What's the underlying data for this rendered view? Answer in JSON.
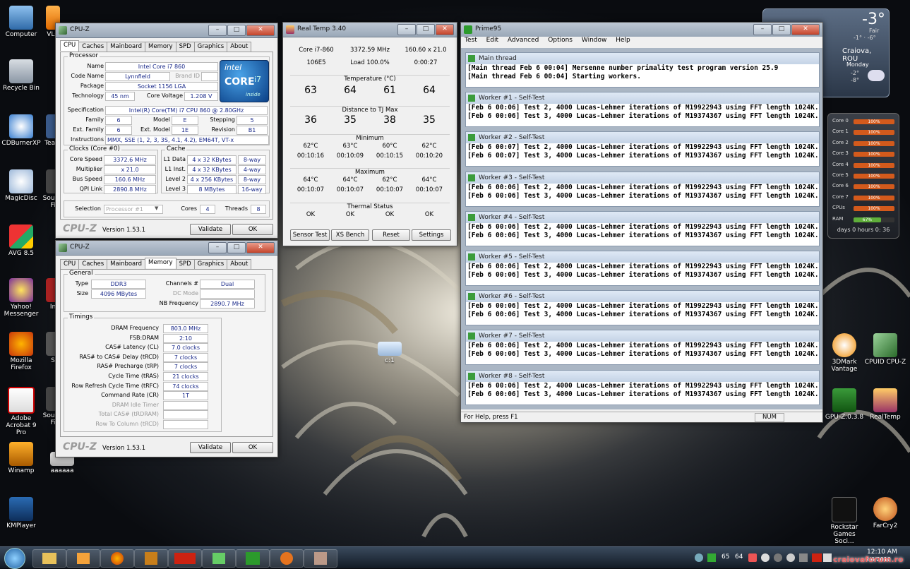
{
  "desktop_icons": [
    "Computer",
    "VLC",
    "Recycle Bin",
    "CDBurnerXP",
    "Team",
    "MagicDisc",
    "Sou X-Fi",
    "AVG 8.5",
    "Yahoo! Messenger",
    "In",
    "Mozilla Firefox",
    "S",
    "Adobe Acrobat 9 Pro",
    "Sou X-Fi",
    "Winamp",
    "aaaaaa",
    "KMPlayer",
    "3DMark Vantage",
    "CPUID CPU-Z",
    "GPU-Z.0.3.8",
    "RealTemp",
    "Rockstar Games Soci...",
    "FarCry2",
    "c:1"
  ],
  "weather": {
    "temp": "-3°",
    "range": "-1° · -6°",
    "cond": "Fair",
    "city": "Craiova, ROU",
    "day": "Monday",
    "lo_hi": "-2°\n-8°"
  },
  "cpuz1": {
    "title": "CPU-Z",
    "tabs": [
      "CPU",
      "Caches",
      "Mainboard",
      "Memory",
      "SPD",
      "Graphics",
      "About"
    ],
    "processor_group": "Processor",
    "name_l": "Name",
    "name": "Intel Core i7 860",
    "codename_l": "Code Name",
    "codename": "Lynnfield",
    "brandid_l": "Brand ID",
    "package_l": "Package",
    "package": "Socket 1156 LGA",
    "tech_l": "Technology",
    "tech": "45 nm",
    "corev_l": "Core Voltage",
    "corev": "1.208 V",
    "spec_l": "Specification",
    "spec": "Intel(R) Core(TM) i7 CPU        860  @ 2.80GHz",
    "family_l": "Family",
    "family": "6",
    "model_l": "Model",
    "model": "E",
    "stepping_l": "Stepping",
    "stepping": "5",
    "extfamily_l": "Ext. Family",
    "extfamily": "6",
    "extmodel_l": "Ext. Model",
    "extmodel": "1E",
    "revision_l": "Revision",
    "revision": "B1",
    "instr_l": "Instructions",
    "instr": "MMX, SSE (1, 2, 3, 3S, 4.1, 4.2), EM64T, VT-x",
    "clocks_group": "Clocks (Core #0)",
    "corespeed_l": "Core Speed",
    "corespeed": "3372.6 MHz",
    "mult_l": "Multiplier",
    "mult": "x 21.0",
    "bus_l": "Bus Speed",
    "bus": "160.6 MHz",
    "qpi_l": "QPI Link",
    "qpi": "2890.8 MHz",
    "cache_group": "Cache",
    "l1d_l": "L1 Data",
    "l1d": "4 x 32 KBytes",
    "l1d_w": "8-way",
    "l1i_l": "L1 Inst.",
    "l1i": "4 x 32 KBytes",
    "l1i_w": "4-way",
    "l2_l": "Level 2",
    "l2": "4 x 256 KBytes",
    "l2_w": "8-way",
    "l3_l": "Level 3",
    "l3": "8 MBytes",
    "l3_w": "16-way",
    "selection_l": "Selection",
    "selection": "Processor #1",
    "cores_l": "Cores",
    "cores": "4",
    "threads_l": "Threads",
    "threads": "8",
    "logo": "CPU-Z",
    "version": "Version 1.53.1",
    "validate": "Validate",
    "ok": "OK",
    "intel_logo": "intel",
    "intel_core": "CORE",
    "intel_i7": "i7",
    "intel_inside": "inside"
  },
  "cpuz2": {
    "title": "CPU-Z",
    "tabs": [
      "CPU",
      "Caches",
      "Mainboard",
      "Memory",
      "SPD",
      "Graphics",
      "About"
    ],
    "general_group": "General",
    "type_l": "Type",
    "type": "DDR3",
    "channels_l": "Channels #",
    "channels": "Dual",
    "size_l": "Size",
    "size": "4096 MBytes",
    "dcmode_l": "DC Mode",
    "nbfreq_l": "NB Frequency",
    "nbfreq": "2890.7 MHz",
    "timings_group": "Timings",
    "timings": [
      {
        "l": "DRAM Frequency",
        "v": "803.0 MHz"
      },
      {
        "l": "FSB:DRAM",
        "v": "2:10"
      },
      {
        "l": "CAS# Latency (CL)",
        "v": "7.0 clocks"
      },
      {
        "l": "RAS# to CAS# Delay (tRCD)",
        "v": "7 clocks"
      },
      {
        "l": "RAS# Precharge (tRP)",
        "v": "7 clocks"
      },
      {
        "l": "Cycle Time (tRAS)",
        "v": "21 clocks"
      },
      {
        "l": "Row Refresh Cycle Time (tRFC)",
        "v": "74 clocks"
      },
      {
        "l": "Command Rate (CR)",
        "v": "1T"
      },
      {
        "l": "DRAM Idle Timer",
        "v": ""
      },
      {
        "l": "Total CAS# (tRDRAM)",
        "v": ""
      },
      {
        "l": "Row To Column (tRCD)",
        "v": ""
      }
    ],
    "logo": "CPU-Z",
    "version": "Version 1.53.1",
    "validate": "Validate",
    "ok": "OK"
  },
  "realtemp": {
    "title": "Real Temp 3.40",
    "cpu": "Core i7-860",
    "mhz": "3372.59 MHz",
    "mult": "160.60 x 21.0",
    "cpuid": "106E5",
    "load": "Load 100.0%",
    "time": "0:00:27",
    "temp_label": "Temperature (°C)",
    "temps": [
      "63",
      "64",
      "61",
      "64"
    ],
    "dist_label": "Distance to TJ Max",
    "dist": [
      "36",
      "35",
      "38",
      "35"
    ],
    "min_label": "Minimum",
    "min": [
      "62°C",
      "63°C",
      "60°C",
      "62°C"
    ],
    "min_t": [
      "00:10:16",
      "00:10:09",
      "00:10:15",
      "00:10:20"
    ],
    "max_label": "Maximum",
    "max": [
      "64°C",
      "64°C",
      "62°C",
      "64°C"
    ],
    "max_t": [
      "00:10:07",
      "00:10:07",
      "00:10:07",
      "00:10:07"
    ],
    "thermal_label": "Thermal Status",
    "thermal": [
      "OK",
      "OK",
      "OK",
      "OK"
    ],
    "buttons": [
      "Sensor Test",
      "XS Bench",
      "Reset",
      "Settings"
    ]
  },
  "prime95": {
    "title": "Prime95",
    "menu": [
      "Test",
      "Edit",
      "Advanced",
      "Options",
      "Window",
      "Help"
    ],
    "panes": [
      {
        "h": "Main thread",
        "l1": "[Main thread Feb 6 00:04] Mersenne number primality test program version 25.9",
        "l2": "[Main thread Feb 6 00:04] Starting workers."
      },
      {
        "h": "Worker #1 - Self-Test",
        "l1": "[Feb 6 00:06] Test 2, 4000 Lucas-Lehmer iterations of M19922943 using FFT length 1024K.",
        "l2": "[Feb 6 00:06] Test 3, 4000 Lucas-Lehmer iterations of M19374367 using FFT length 1024K."
      },
      {
        "h": "Worker #2 - Self-Test",
        "l1": "[Feb 6 00:07] Test 2, 4000 Lucas-Lehmer iterations of M19922943 using FFT length 1024K.",
        "l2": "[Feb 6 00:07] Test 3, 4000 Lucas-Lehmer iterations of M19374367 using FFT length 1024K."
      },
      {
        "h": "Worker #3 - Self-Test",
        "l1": "[Feb 6 00:06] Test 2, 4000 Lucas-Lehmer iterations of M19922943 using FFT length 1024K.",
        "l2": "[Feb 6 00:06] Test 3, 4000 Lucas-Lehmer iterations of M19374367 using FFT length 1024K."
      },
      {
        "h": "Worker #4 - Self-Test",
        "l1": "[Feb 6 00:06] Test 2, 4000 Lucas-Lehmer iterations of M19922943 using FFT length 1024K.",
        "l2": "[Feb 6 00:06] Test 3, 4000 Lucas-Lehmer iterations of M19374367 using FFT length 1024K."
      },
      {
        "h": "Worker #5 - Self-Test",
        "l1": "[Feb 6 00:06] Test 2, 4000 Lucas-Lehmer iterations of M19922943 using FFT length 1024K.",
        "l2": "[Feb 6 00:06] Test 3, 4000 Lucas-Lehmer iterations of M19374367 using FFT length 1024K."
      },
      {
        "h": "Worker #6 - Self-Test",
        "l1": "[Feb 6 00:06] Test 2, 4000 Lucas-Lehmer iterations of M19922943 using FFT length 1024K.",
        "l2": "[Feb 6 00:06] Test 3, 4000 Lucas-Lehmer iterations of M19374367 using FFT length 1024K."
      },
      {
        "h": "Worker #7 - Self-Test",
        "l1": "[Feb 6 00:06] Test 2, 4000 Lucas-Lehmer iterations of M19922943 using FFT length 1024K.",
        "l2": "[Feb 6 00:06] Test 3, 4000 Lucas-Lehmer iterations of M19374367 using FFT length 1024K."
      },
      {
        "h": "Worker #8 - Self-Test",
        "l1": "[Feb 6 00:06] Test 2, 4000 Lucas-Lehmer iterations of M19922943 using FFT length 1024K.",
        "l2": "[Feb 6 00:06] Test 3, 4000 Lucas-Lehmer iterations of M19374367 using FFT length 1024K."
      }
    ],
    "status": "For Help, press F1",
    "num": "NUM"
  },
  "cpumeter": {
    "rows": [
      {
        "l": "Core 0",
        "v": "100%",
        "frac": 1.0
      },
      {
        "l": "Core 1",
        "v": "100%",
        "frac": 1.0
      },
      {
        "l": "Core 2",
        "v": "100%",
        "frac": 1.0
      },
      {
        "l": "Core 3",
        "v": "100%",
        "frac": 1.0
      },
      {
        "l": "Core 4",
        "v": "100%",
        "frac": 1.0
      },
      {
        "l": "Core 5",
        "v": "100%",
        "frac": 1.0
      },
      {
        "l": "Core 6",
        "v": "100%",
        "frac": 1.0
      },
      {
        "l": "Core 7",
        "v": "100%",
        "frac": 1.0
      },
      {
        "l": "CPUs",
        "v": "100%",
        "frac": 1.0
      },
      {
        "l": "RAM",
        "v": "67%",
        "frac": 0.67
      }
    ],
    "uptime": "days 0 hours 0: 36"
  },
  "taskbar": {
    "tray_temps": [
      "65",
      "64"
    ],
    "clock": "12:10 AM",
    "date": "2/6/2010",
    "watermark": "craiovaforum.ro"
  }
}
